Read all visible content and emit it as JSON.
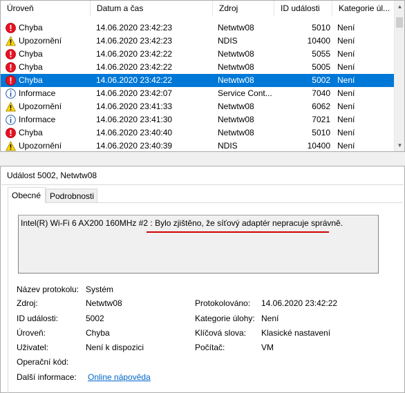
{
  "columns": {
    "level": "Úroveň",
    "datetime": "Datum a čas",
    "source": "Zdroj",
    "event_id": "ID události",
    "task_category": "Kategorie úl..."
  },
  "events": [
    {
      "level": "Chyba",
      "icon": "error-icon",
      "datetime": "14.06.2020 23:42:23",
      "source": "Netwtw08",
      "event_id": "5010",
      "category": "Není"
    },
    {
      "level": "Upozornění",
      "icon": "warning-icon",
      "datetime": "14.06.2020 23:42:23",
      "source": "NDIS",
      "event_id": "10400",
      "category": "Není"
    },
    {
      "level": "Chyba",
      "icon": "error-icon",
      "datetime": "14.06.2020 23:42:22",
      "source": "Netwtw08",
      "event_id": "5055",
      "category": "Není"
    },
    {
      "level": "Chyba",
      "icon": "error-icon",
      "datetime": "14.06.2020 23:42:22",
      "source": "Netwtw08",
      "event_id": "5005",
      "category": "Není"
    },
    {
      "level": "Chyba",
      "icon": "error-icon",
      "datetime": "14.06.2020 23:42:22",
      "source": "Netwtw08",
      "event_id": "5002",
      "category": "Není",
      "selected": true
    },
    {
      "level": "Informace",
      "icon": "info-icon",
      "datetime": "14.06.2020 23:42:07",
      "source": "Service Cont...",
      "event_id": "7040",
      "category": "Není"
    },
    {
      "level": "Upozornění",
      "icon": "warning-icon",
      "datetime": "14.06.2020 23:41:33",
      "source": "Netwtw08",
      "event_id": "6062",
      "category": "Není"
    },
    {
      "level": "Informace",
      "icon": "info-icon",
      "datetime": "14.06.2020 23:41:30",
      "source": "Netwtw08",
      "event_id": "7021",
      "category": "Není"
    },
    {
      "level": "Chyba",
      "icon": "error-icon",
      "datetime": "14.06.2020 23:40:40",
      "source": "Netwtw08",
      "event_id": "5010",
      "category": "Není"
    },
    {
      "level": "Upozornění",
      "icon": "warning-icon",
      "datetime": "14.06.2020 23:40:39",
      "source": "NDIS",
      "event_id": "10400",
      "category": "Není"
    }
  ],
  "detail": {
    "title": "Událost 5002, Netwtw08",
    "tabs": [
      "Obecné",
      "Podrobnosti"
    ],
    "active_tab": "Obecné",
    "description_prefix": "Intel(R) Wi-Fi 6 AX200 160MHz #2 : ",
    "description_message": "Bylo zjištěno, že síťový adaptér nepracuje správně.",
    "properties": {
      "log_name_label": "Název protokolu:",
      "log_name": "Systém",
      "source_label": "Zdroj:",
      "source": "Netwtw08",
      "logged_label": "Protokolováno:",
      "logged": "14.06.2020 23:42:22",
      "event_id_label": "ID události:",
      "event_id": "5002",
      "task_category_label": "Kategorie úlohy:",
      "task_category": "Není",
      "level_label": "Úroveň:",
      "level": "Chyba",
      "keywords_label": "Klíčová slova:",
      "keywords": "Klasické nastavení",
      "user_label": "Uživatel:",
      "user": "Není k dispozici",
      "computer_label": "Počítač:",
      "computer": "VM",
      "opcode_label": "Operační kód:",
      "opcode": "",
      "more_info_label": "Další informace:",
      "more_info_link": "Online nápověda"
    }
  },
  "colors": {
    "selection": "#0078d7",
    "error": "#e81123",
    "warning": "#ffd800",
    "info": "#ffffff",
    "highlight_underline": "#d00000",
    "link": "#0066cc"
  }
}
